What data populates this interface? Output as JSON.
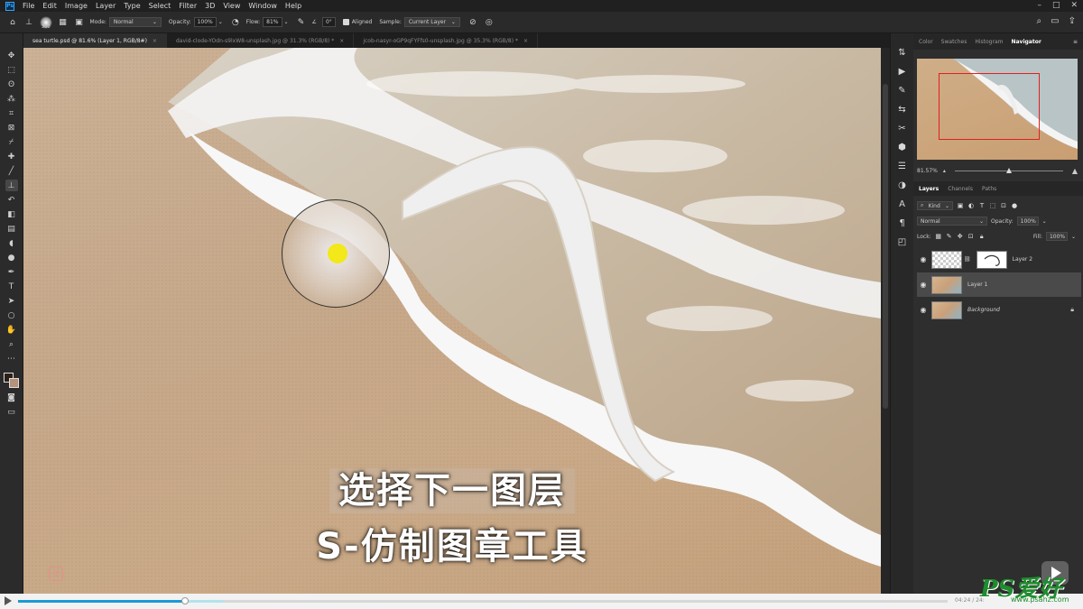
{
  "menubar": {
    "items": [
      "File",
      "Edit",
      "Image",
      "Layer",
      "Type",
      "Select",
      "Filter",
      "3D",
      "View",
      "Window",
      "Help"
    ]
  },
  "options": {
    "brush_size": "300",
    "mode_label": "Mode:",
    "mode_value": "Normal",
    "opacity_label": "Opacity:",
    "opacity_value": "100%",
    "flow_label": "Flow:",
    "flow_value": "81%",
    "angle_value": "0°",
    "aligned_label": "Aligned",
    "sample_label": "Sample:",
    "sample_value": "Current Layer"
  },
  "tabs": [
    {
      "label": "sea turtle.psd @ 81.6% (Layer 1, RGB/8#)"
    },
    {
      "label": "david-clode-YOdn-s9lxW8-unsplash.jpg @ 31.3% (RGB/8) *"
    },
    {
      "label": "jcob-nasyr-oGP9qFYFfs0-unsplash.jpg @ 35.3% (RGB/8) *"
    }
  ],
  "canvas": {
    "subtitle_line1": "选择下一图层",
    "subtitle_line2": "S-仿制图章工具"
  },
  "panel": {
    "top_tabs": [
      "Color",
      "Swatches",
      "Histogram",
      "Navigator"
    ],
    "zoom_value": "81.57%",
    "layer_tabs": [
      "Layers",
      "Channels",
      "Paths"
    ],
    "kind_label": "Kind",
    "blend_mode": "Normal",
    "opacity_label": "Opacity:",
    "opacity_value": "100%",
    "lock_label": "Lock:",
    "fill_label": "Fill:",
    "fill_value": "100%",
    "layers": [
      {
        "name": "Layer 2"
      },
      {
        "name": "Layer 1"
      },
      {
        "name": "Background"
      }
    ]
  },
  "video": {
    "progress": 0.18,
    "buffered": 0.22,
    "time": "04:24 / 24:"
  },
  "watermark": {
    "brand": "PS爱好者",
    "url": "www.psahz.com"
  },
  "colors": {
    "accent": "#1a9ad6",
    "foreground": "#2b2018",
    "background": "#b5927a"
  }
}
